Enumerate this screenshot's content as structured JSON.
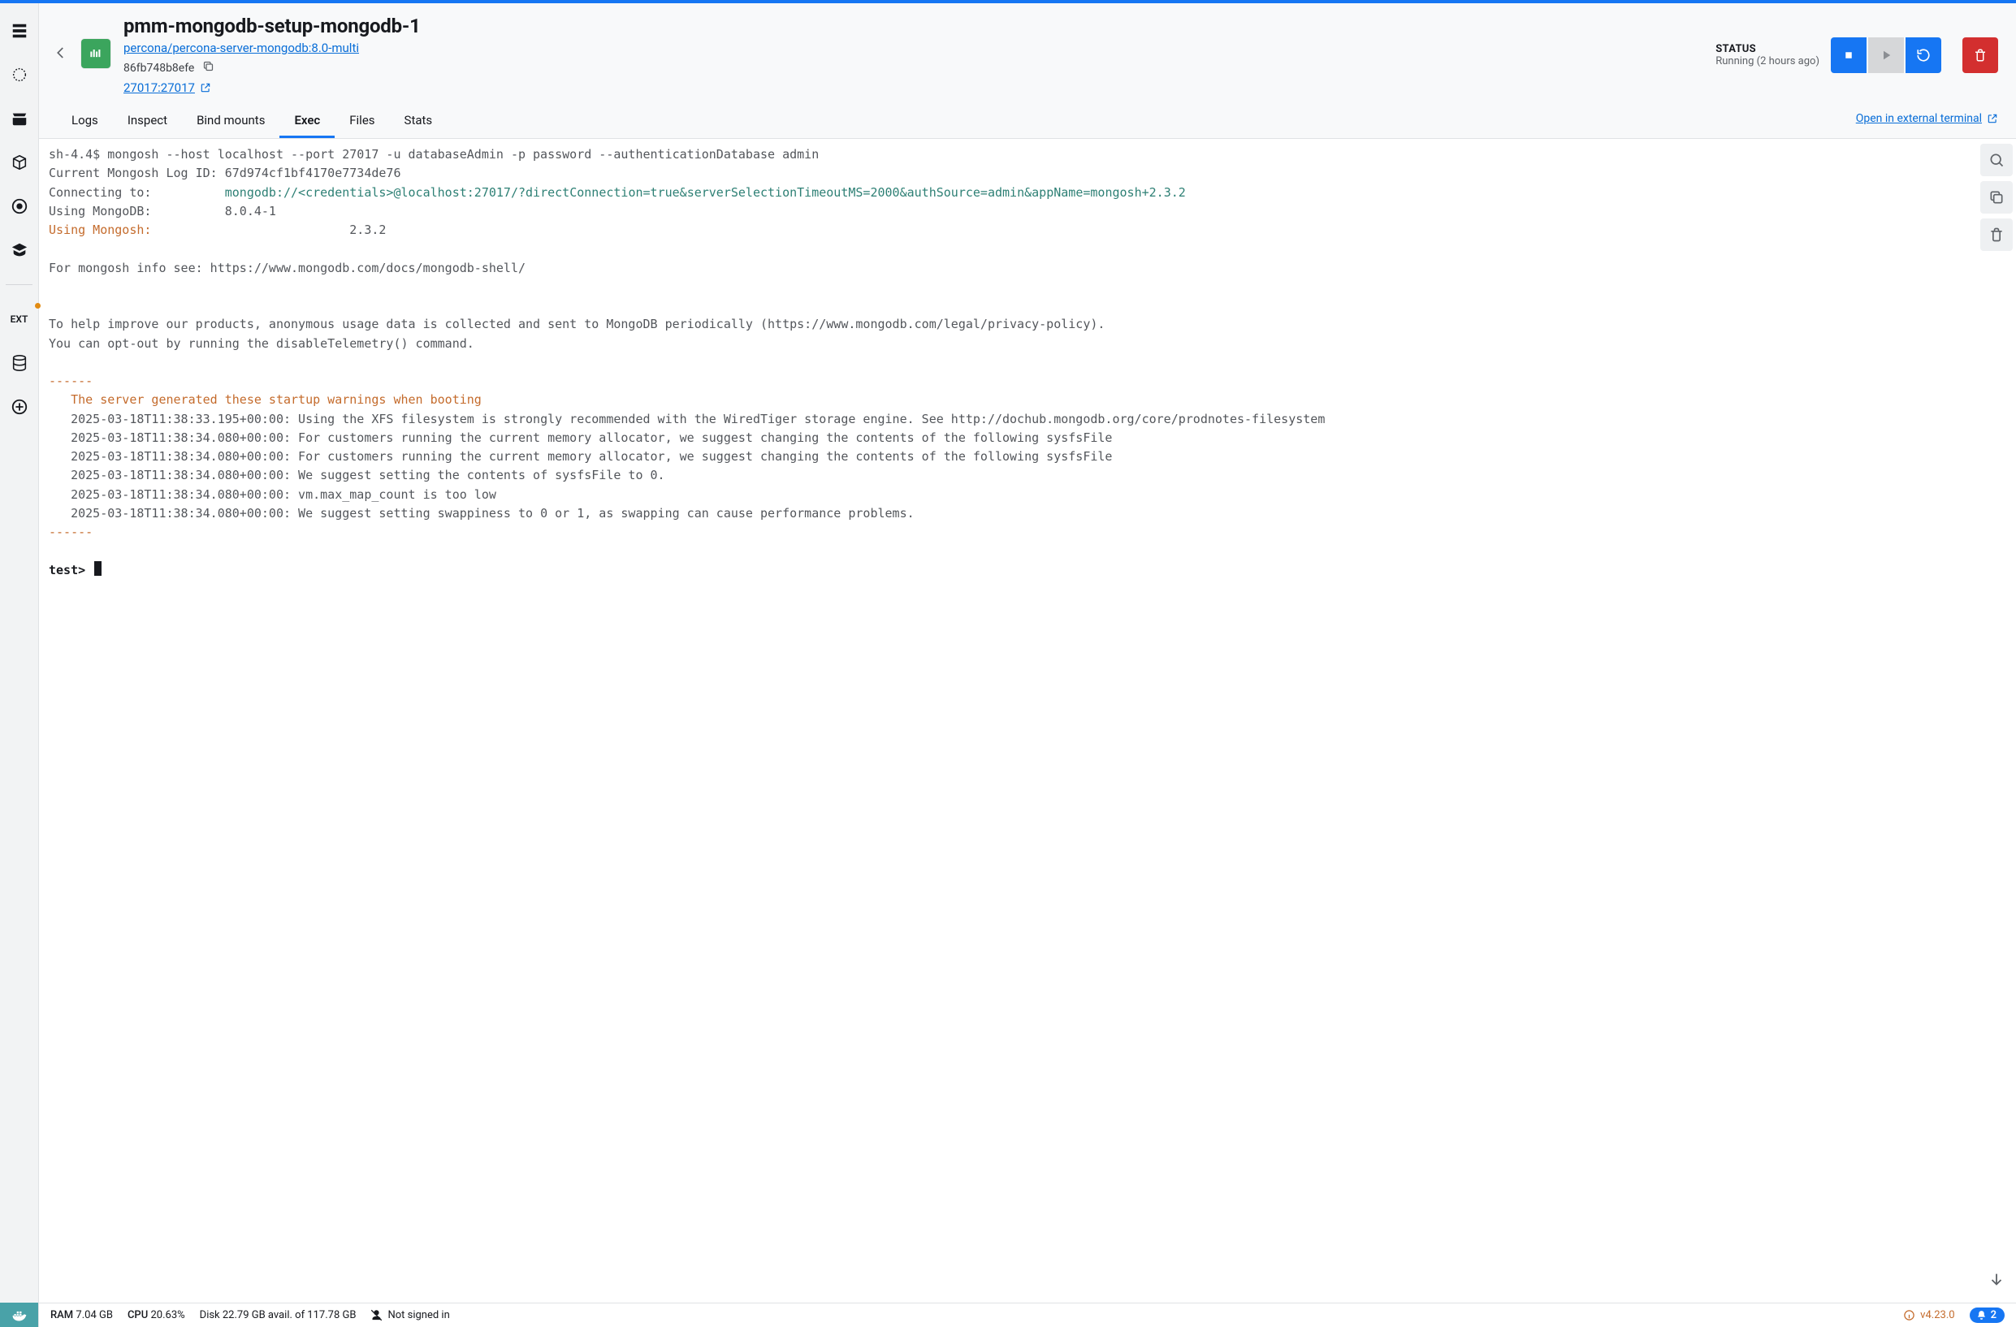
{
  "header": {
    "title": "pmm-mongodb-setup-mongodb-1",
    "image": "percona/percona-server-mongodb:8.0-multi",
    "container_id": "86fb748b8efe",
    "port_mapping": "27017:27017",
    "status_label": "STATUS",
    "status_value": "Running (2 hours ago)"
  },
  "tabs": {
    "items": [
      "Logs",
      "Inspect",
      "Bind mounts",
      "Exec",
      "Files",
      "Stats"
    ],
    "active": "Exec",
    "external_link": "Open in external terminal"
  },
  "sidebar": {
    "ext_label": "EXT"
  },
  "terminal": {
    "cmd_line": "sh-4.4$ mongosh --host localhost --port 27017 -u databaseAdmin -p password --authenticationDatabase admin",
    "log_id_label": "Current Mongosh Log ID:",
    "log_id": "67d974cf1bf4170e7734de76",
    "connecting_label": "Connecting to:",
    "connecting_url": "mongodb://<credentials>@localhost:27017/?directConnection=true&serverSelectionTimeoutMS=2000&authSource=admin&appName=mongosh+2.3.2",
    "using_mongodb_label": "Using MongoDB:",
    "using_mongodb_value": "8.0.4-1",
    "using_mongosh_label": "Using Mongosh:",
    "using_mongosh_value": "2.3.2",
    "info_line": "For mongosh info see: https://www.mongodb.com/docs/mongodb-shell/",
    "telemetry_para": "To help improve our products, anonymous usage data is collected and sent to MongoDB periodically (https://www.mongodb.com/legal/privacy-policy).\nYou can opt-out by running the disableTelemetry() command.",
    "dashes": "------",
    "warn_header": "   The server generated these startup warnings when booting",
    "warn_lines": [
      "   2025-03-18T11:38:33.195+00:00: Using the XFS filesystem is strongly recommended with the WiredTiger storage engine. See http://dochub.mongodb.org/core/prodnotes-filesystem",
      "   2025-03-18T11:38:34.080+00:00: For customers running the current memory allocator, we suggest changing the contents of the following sysfsFile",
      "   2025-03-18T11:38:34.080+00:00: For customers running the current memory allocator, we suggest changing the contents of the following sysfsFile",
      "   2025-03-18T11:38:34.080+00:00: We suggest setting the contents of sysfsFile to 0.",
      "   2025-03-18T11:38:34.080+00:00: vm.max_map_count is too low",
      "   2025-03-18T11:38:34.080+00:00: We suggest setting swappiness to 0 or 1, as swapping can cause performance problems."
    ],
    "prompt": "test>"
  },
  "footer": {
    "ram_label": "RAM",
    "ram_value": "7.04 GB",
    "cpu_label": "CPU",
    "cpu_value": "20.63%",
    "disk_text": "Disk 22.79 GB avail. of 117.78 GB",
    "signin": "Not signed in",
    "version": "v4.23.0",
    "notif_count": "2"
  }
}
